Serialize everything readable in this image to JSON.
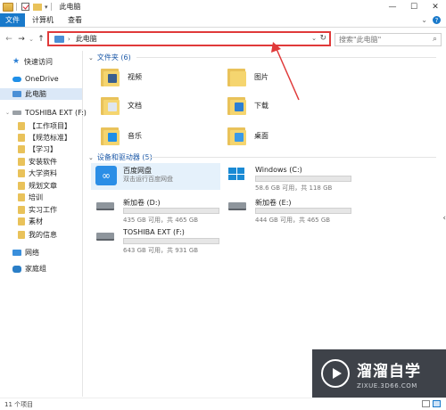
{
  "window": {
    "title": "此电脑",
    "controls": {
      "minimize": "—",
      "maximize": "☐",
      "close": "✕"
    }
  },
  "ribbon": {
    "tabs": [
      "文件",
      "计算机",
      "查看"
    ],
    "collapse": "⌄",
    "help": "?"
  },
  "nav": {
    "back": "←",
    "forward": "→",
    "recent": "⌄",
    "up": "↑",
    "address_text": "此电脑",
    "address_dropdown": "⌄",
    "refresh": "↻",
    "search_placeholder": "搜索\"此电脑\"",
    "search_icon": "⌕"
  },
  "sidebar": {
    "quick_access": "快速访问",
    "onedrive": "OneDrive",
    "this_pc": "此电脑",
    "drive": "TOSHIBA EXT (F:)",
    "folders": [
      "【工作项目】",
      "【规范标准】",
      "【学习】",
      "安装软件",
      "大学资料",
      "规划文章",
      "培训",
      "实习工作",
      "素材",
      "我的信息"
    ],
    "network": "网络",
    "homegroup": "家庭组"
  },
  "folders_group": {
    "header": "文件夹 (6)",
    "items": [
      {
        "label": "视频",
        "glyph_color": "#3a5f8f"
      },
      {
        "label": "图片",
        "glyph_color": "#f5d56f"
      },
      {
        "label": "文档",
        "glyph_color": "#dfe6ee"
      },
      {
        "label": "下载",
        "glyph_color": "#2b7fd4"
      },
      {
        "label": "音乐",
        "glyph_color": "#1f8fe8"
      },
      {
        "label": "桌面",
        "glyph_color": "#3a9ae8"
      }
    ]
  },
  "drives_group": {
    "header": "设备和驱动器 (5)",
    "baidu": {
      "name": "百度网盘",
      "sub": "双击运行百度网盘"
    },
    "drives": [
      {
        "name": "Windows (C:)",
        "free": "58.6 GB 可用，共 118 GB",
        "used": 0.5
      },
      {
        "name": "新加卷 (D:)",
        "free": "435 GB 可用，共 465 GB",
        "used": 0.07
      },
      {
        "name": "新加卷 (E:)",
        "free": "444 GB 可用，共 465 GB",
        "used": 0.05
      },
      {
        "name": "TOSHIBA EXT (F:)",
        "free": "643 GB 可用，共 931 GB",
        "used": 0.31
      }
    ]
  },
  "status": {
    "count": "11 个项目"
  },
  "watermark": {
    "title": "溜溜自学",
    "url": "ZIXUE.3D66.COM"
  },
  "colors": {
    "accent": "#1979ca",
    "highlight_box": "#e03a3a",
    "bar_fill": "#26a0da"
  }
}
